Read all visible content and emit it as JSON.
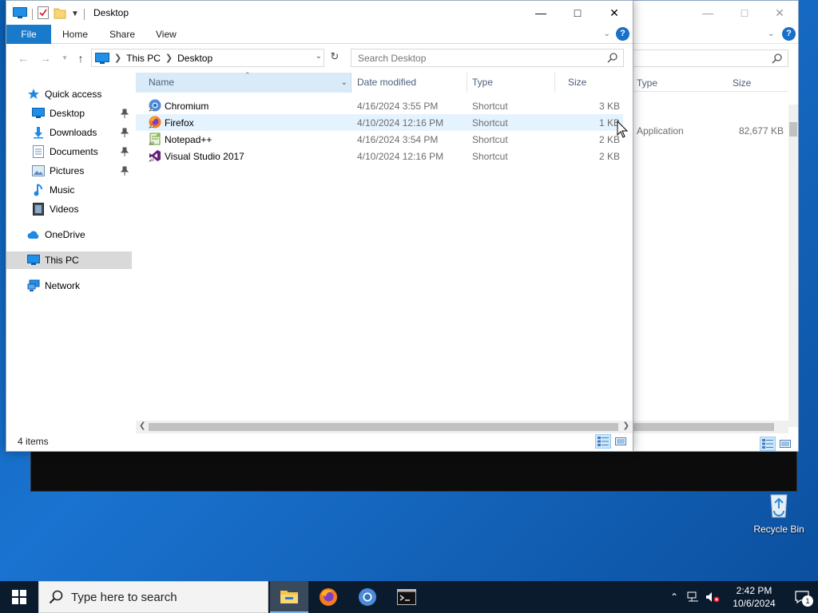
{
  "desktop": {
    "recycle_bin": "Recycle Bin"
  },
  "background_window": {
    "columns": {
      "type": "Type",
      "size": "Size"
    },
    "row": {
      "type": "Application",
      "size": "82,677 KB"
    }
  },
  "window": {
    "title": "Desktop",
    "ribbon_tabs": {
      "file": "File",
      "home": "Home",
      "share": "Share",
      "view": "View"
    },
    "address": {
      "crumbs": [
        "This PC",
        "Desktop"
      ]
    },
    "search": {
      "placeholder": "Search Desktop"
    },
    "nav": {
      "quick_access": "Quick access",
      "desktop": "Desktop",
      "downloads": "Downloads",
      "documents": "Documents",
      "pictures": "Pictures",
      "music": "Music",
      "videos": "Videos",
      "onedrive": "OneDrive",
      "this_pc": "This PC",
      "network": "Network"
    },
    "columns": {
      "name": "Name",
      "date": "Date modified",
      "type": "Type",
      "size": "Size"
    },
    "files": [
      {
        "name": "Chromium",
        "date": "4/16/2024 3:55 PM",
        "type": "Shortcut",
        "size": "3 KB",
        "icon": "chromium-icon"
      },
      {
        "name": "Firefox",
        "date": "4/10/2024 12:16 PM",
        "type": "Shortcut",
        "size": "1 KB",
        "icon": "firefox-icon"
      },
      {
        "name": "Notepad++",
        "date": "4/16/2024 3:54 PM",
        "type": "Shortcut",
        "size": "2 KB",
        "icon": "notepadpp-icon"
      },
      {
        "name": "Visual Studio 2017",
        "date": "4/10/2024 12:16 PM",
        "type": "Shortcut",
        "size": "2 KB",
        "icon": "visual-studio-icon"
      }
    ],
    "status": {
      "count": "4 items"
    }
  },
  "taskbar": {
    "search_placeholder": "Type here to search",
    "time": "2:42 PM",
    "date": "10/6/2024",
    "notification_count": "1"
  },
  "colors": {
    "accent": "#1979ca",
    "taskbar": "#0b1b2e",
    "selection": "#cce8ff"
  }
}
